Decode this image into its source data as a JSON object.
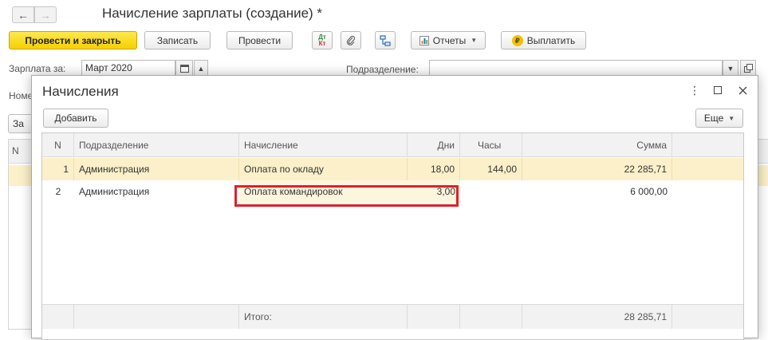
{
  "document": {
    "title": "Начисление зарплаты (создание) *",
    "nav_back": "←",
    "nav_forward": "→",
    "toolbar": {
      "post_close": "Провести и закрыть",
      "save": "Записать",
      "post": "Провести",
      "dt_label": "Дт",
      "kt_label": "Кт",
      "reports": "Отчеты",
      "pay": "Выплатить",
      "ruble_glyph": "₽"
    },
    "salary_for_label": "Зарплата за:",
    "salary_for_value": "Март 2020",
    "department_label": "Подразделение:",
    "department_value": "",
    "number_label_fragment": "Номе",
    "button_fragment": "За",
    "grid_header_fragment": "N"
  },
  "modal": {
    "title": "Начисления",
    "add_button": "Добавить",
    "more_button": "Еще",
    "columns": [
      "N",
      "Подразделение",
      "Начисление",
      "Дни",
      "Часы",
      "Сумма"
    ],
    "rows": [
      {
        "n": "1",
        "department": "Администрация",
        "accrual": "Оплата по окладу",
        "days": "18,00",
        "hours": "144,00",
        "amount": "22 285,71"
      },
      {
        "n": "2",
        "department": "Администрация",
        "accrual": "Оплата командировок",
        "days": "3,00",
        "hours": "",
        "amount": "6 000,00"
      }
    ],
    "footer": {
      "total_label": "Итого:",
      "total_amount": "28 285,71"
    }
  },
  "colors": {
    "primary_button": "#f5d000",
    "selected_row": "#fbf0c9",
    "highlight_border": "#e0202c"
  },
  "icons": {
    "more_options": "vertical-ellipsis-icon",
    "maximize": "maximize-icon",
    "close": "close-icon",
    "attach": "paperclip-icon",
    "structure": "hierarchy-icon",
    "calendar": "calendar-icon"
  }
}
